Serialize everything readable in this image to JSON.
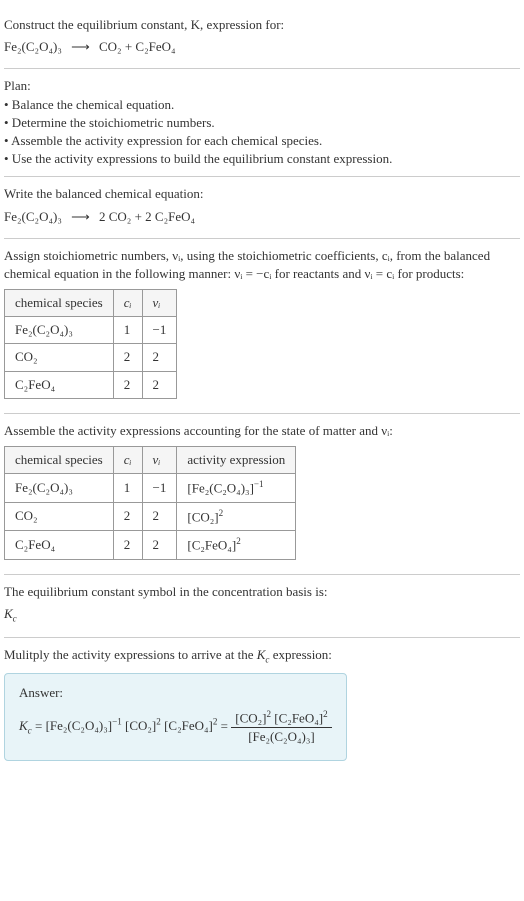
{
  "intro": {
    "line1": "Construct the equilibrium constant, K, expression for:",
    "equation_lhs": "Fe₂(C₂O₄)₃",
    "equation_arrow": "⟶",
    "equation_rhs": "CO₂ + C₂FeO₄"
  },
  "plan": {
    "heading": "Plan:",
    "items": [
      "• Balance the chemical equation.",
      "• Determine the stoichiometric numbers.",
      "• Assemble the activity expression for each chemical species.",
      "• Use the activity expressions to build the equilibrium constant expression."
    ]
  },
  "balanced": {
    "heading": "Write the balanced chemical equation:",
    "equation_lhs": "Fe₂(C₂O₄)₃",
    "equation_arrow": "⟶",
    "equation_rhs": "2 CO₂ + 2 C₂FeO₄"
  },
  "stoich": {
    "text": "Assign stoichiometric numbers, νᵢ, using the stoichiometric coefficients, cᵢ, from the balanced chemical equation in the following manner: νᵢ = −cᵢ for reactants and νᵢ = cᵢ for products:",
    "headers": [
      "chemical species",
      "cᵢ",
      "νᵢ"
    ],
    "rows": [
      {
        "species": "Fe₂(C₂O₄)₃",
        "c": "1",
        "v": "−1"
      },
      {
        "species": "CO₂",
        "c": "2",
        "v": "2"
      },
      {
        "species": "C₂FeO₄",
        "c": "2",
        "v": "2"
      }
    ]
  },
  "activity": {
    "text": "Assemble the activity expressions accounting for the state of matter and νᵢ:",
    "headers": [
      "chemical species",
      "cᵢ",
      "νᵢ",
      "activity expression"
    ],
    "rows": [
      {
        "species": "Fe₂(C₂O₄)₃",
        "c": "1",
        "v": "−1",
        "expr_base": "[Fe₂(C₂O₄)₃]",
        "expr_exp": "−1"
      },
      {
        "species": "CO₂",
        "c": "2",
        "v": "2",
        "expr_base": "[CO₂]",
        "expr_exp": "2"
      },
      {
        "species": "C₂FeO₄",
        "c": "2",
        "v": "2",
        "expr_base": "[C₂FeO₄]",
        "expr_exp": "2"
      }
    ]
  },
  "symbol": {
    "text": "The equilibrium constant symbol in the concentration basis is:",
    "value": "K_c"
  },
  "multiply": {
    "text": "Mulitply the activity expressions to arrive at the K_c expression:"
  },
  "answer": {
    "label": "Answer:",
    "kc": "K_c",
    "eq": " = ",
    "term1_base": "[Fe₂(C₂O₄)₃]",
    "term1_exp": "−1",
    "term2_base": "[CO₂]",
    "term2_exp": "2",
    "term3_base": "[C₂FeO₄]",
    "term3_exp": "2",
    "frac_num_a_base": "[CO₂]",
    "frac_num_a_exp": "2",
    "frac_num_b_base": "[C₂FeO₄]",
    "frac_num_b_exp": "2",
    "frac_den": "[Fe₂(C₂O₄)₃]"
  }
}
